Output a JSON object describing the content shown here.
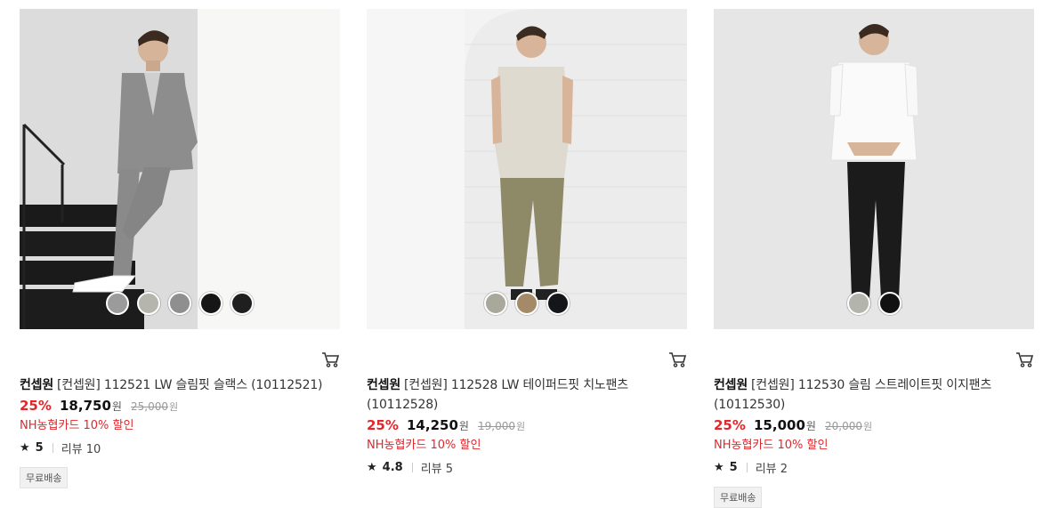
{
  "products": [
    {
      "brand": "컨셉원",
      "name": "[컨셉원] 112521 LW 슬림핏 슬랙스 (10112521)",
      "discount": "25%",
      "price": "18,750",
      "won": "원",
      "original_price": "25,000",
      "original_won": "원",
      "card_promo": "NH농협카드 10% 할인",
      "rating": "5",
      "review": "리뷰 10",
      "badge": "무료배송",
      "swatches": [
        "#9b9b9b",
        "#b5b5ad",
        "#8f8f8f",
        "#161616",
        "#1f1f1f"
      ]
    },
    {
      "brand": "컨셉원",
      "name": "[컨셉원] 112528 LW 테이퍼드핏 치노팬츠 (10112528)",
      "discount": "25%",
      "price": "14,250",
      "won": "원",
      "original_price": "19,000",
      "original_won": "원",
      "card_promo": "NH농협카드 10% 할인",
      "rating": "4.8",
      "review": "리뷰 5",
      "swatches": [
        "#a9a99b",
        "#a48a67",
        "#15161a"
      ]
    },
    {
      "brand": "컨셉원",
      "name": "[컨셉원] 112530 슬림 스트레이트핏 이지팬츠 (10112530)",
      "discount": "25%",
      "price": "15,000",
      "won": "원",
      "original_price": "20,000",
      "original_won": "원",
      "card_promo": "NH농협카드 10% 할인",
      "rating": "5",
      "review": "리뷰 2",
      "badge": "무료배송",
      "swatches": [
        "#b3b4ab",
        "#111111"
      ]
    }
  ],
  "icons": {
    "cart": "cart-icon",
    "star": "star-icon"
  },
  "colors": {
    "discount": "#e0282c",
    "promo": "#e0282c"
  }
}
